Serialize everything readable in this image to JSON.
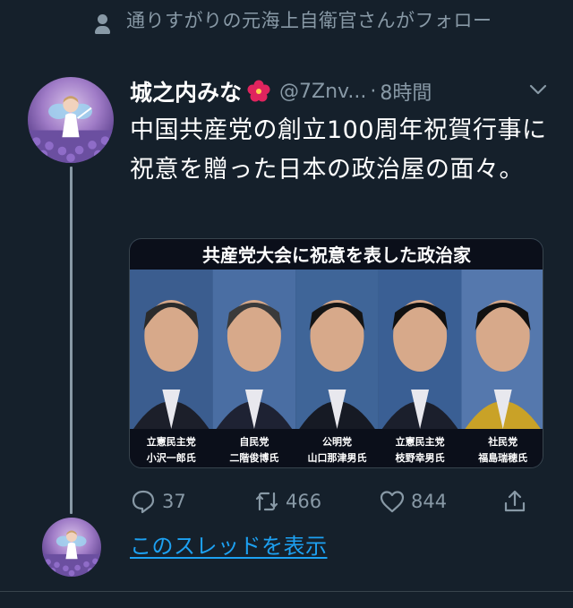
{
  "context": {
    "icon": "person-icon",
    "text": "通りすがりの元海上自衛官さんがフォロー"
  },
  "tweet": {
    "display_name": "城之内みな",
    "name_emoji": "hibiscus-icon",
    "handle": "@7Znv...",
    "separator": "·",
    "time": "8時間",
    "menu_icon": "chevron-down-icon",
    "text": "中国共産党の創立100周年祝賀行事に祝意を贈った日本の政治屋の面々。",
    "media": {
      "caption": "共産党大会に祝意を表した政治家",
      "people": [
        {
          "party": "立憲民主党",
          "name": "小沢一郎氏"
        },
        {
          "party": "自民党",
          "name": "二階俊博氏"
        },
        {
          "party": "公明党",
          "name": "山口那津男氏"
        },
        {
          "party": "立憲民主党",
          "name": "枝野幸男氏"
        },
        {
          "party": "社民党",
          "name": "福島瑞穂氏"
        }
      ]
    },
    "actions": {
      "reply_count": "37",
      "retweet_count": "466",
      "like_count": "844"
    }
  },
  "show_thread_label": "このスレッドを表示",
  "colors": {
    "background": "#15202b",
    "secondary_text": "#8899a6",
    "link": "#1da1f2",
    "thread_line": "#8899a6"
  }
}
